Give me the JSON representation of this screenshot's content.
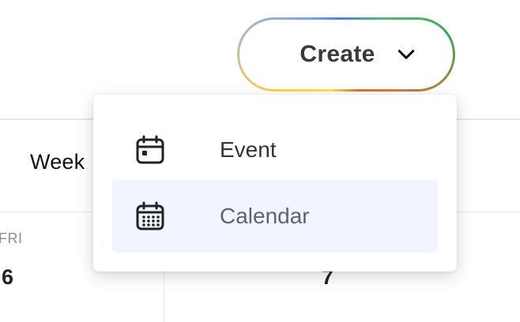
{
  "header": {
    "create_label": "Create",
    "create_icon": "chevron-down-icon"
  },
  "create_menu": {
    "items": [
      {
        "label": "Event",
        "icon": "calendar-icon"
      },
      {
        "label": "Calendar",
        "icon": "calendar-grid-icon",
        "highlighted": true
      }
    ]
  },
  "calendar_view": {
    "view_button": "Week",
    "days": [
      {
        "name": "FRI",
        "number": "6"
      },
      {
        "name": "",
        "number": "7"
      }
    ]
  },
  "colors": {
    "menu_highlight": "#f0f5ff",
    "gradient": [
      "#4a7ff2",
      "#3da755",
      "#e96a3a",
      "#ffd54a"
    ]
  }
}
